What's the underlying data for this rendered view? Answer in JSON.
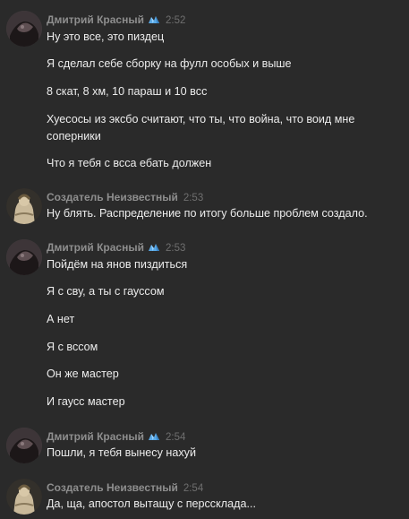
{
  "users": {
    "dmitriy": "Дмитрий Красный",
    "creator": "Создатель Неизвестный"
  },
  "badge_icon": "ice-crystal-icon",
  "groups": [
    {
      "author": "Дмитрий Красный",
      "time": "2:52",
      "messages": [
        "Ну это все, это пиздец",
        "Я сделал себе сборку на фулл особых и выше",
        "8 скат, 8 хм, 10 параш и 10 вcс",
        "Хуесосы из эксбо считают, что ты, что война, что воид мне соперники",
        "Что я тебя с всса ебать должен"
      ]
    },
    {
      "author": "Создатель Неизвестный",
      "time": "2:53",
      "messages": [
        "Ну блять. Распределение по итогу больше проблем создало."
      ]
    },
    {
      "author": "Дмитрий Красный",
      "time": "2:53",
      "messages": [
        "Пойдём на янов пиздиться",
        "Я с сву, а ты с гауссом",
        "А нет",
        "Я с вссом",
        "Он же мастер",
        "И гаусс мастер"
      ]
    },
    {
      "author": "Дмитрий Красный",
      "time": "2:54",
      "messages": [
        "Пошли, я тебя вынесу нахуй"
      ]
    },
    {
      "author": "Создатель Неизвестный",
      "time": "2:54",
      "messages": [
        "Да, ща, апостол вытащу с перссклада..."
      ]
    }
  ]
}
